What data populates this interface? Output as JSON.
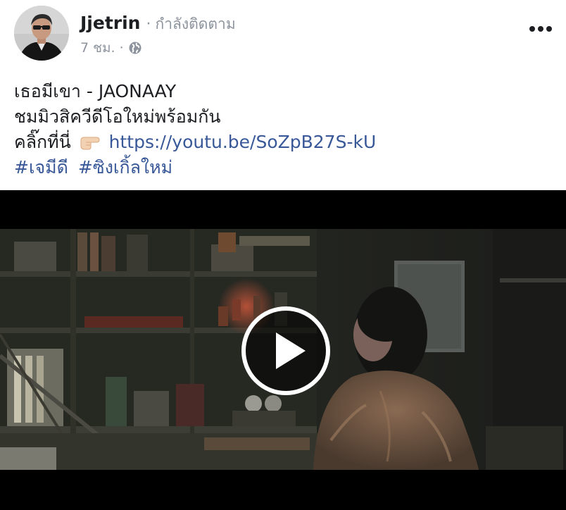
{
  "post": {
    "author": {
      "name": "Jjetrin",
      "follow_status": "กำลังติดตาม",
      "avatar_icon": "profile-photo"
    },
    "meta": {
      "timestamp": "7 ชม.",
      "privacy_icon": "globe-icon"
    },
    "more_icon": "more-horizontal-icon",
    "text": {
      "line1": "เธอมีเขา - JAONAAY",
      "line2": "ชมมิวสิควีดีโอใหม่พร้อมกัน",
      "line3_prefix": "คลิ๊กที่นี่",
      "line3_emoji": "pointing-right-emoji",
      "link": "https://youtu.be/SoZpB27S-kU",
      "hashtags": [
        "#เจมีดี",
        "#ซิงเกิ้ลใหม่"
      ]
    },
    "video": {
      "play_icon": "play-icon"
    }
  },
  "colors": {
    "link": "#385898",
    "text": "#1c1e21",
    "secondary": "#8d949e",
    "video_bg": "#000000"
  }
}
